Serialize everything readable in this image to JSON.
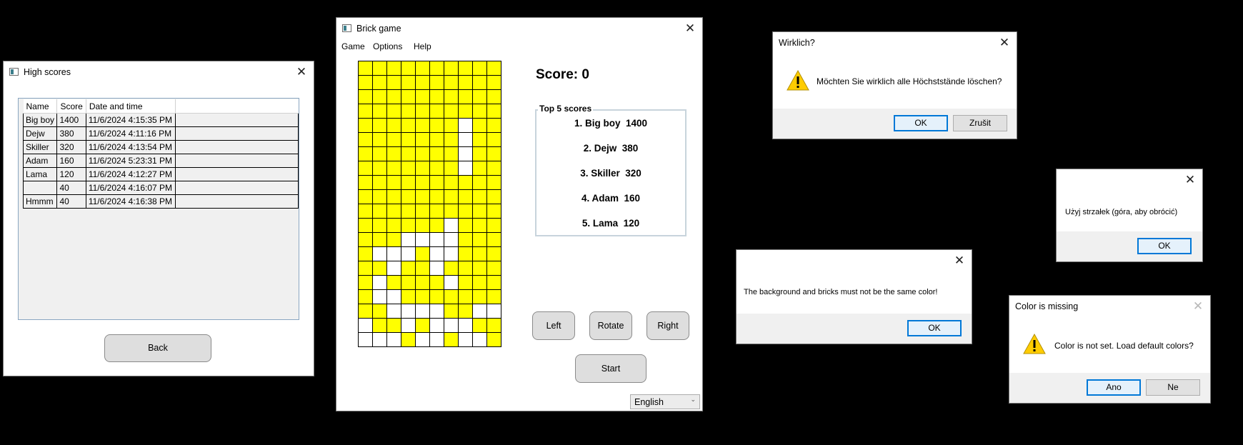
{
  "high_scores_window": {
    "title": "High scores",
    "columns": [
      "Name",
      "Score",
      "Date and time"
    ],
    "rows": [
      {
        "name": "Big boy",
        "score": "1400",
        "date": "11/6/2024 4:15:35 PM"
      },
      {
        "name": "Dejw",
        "score": "380",
        "date": "11/6/2024 4:11:16 PM"
      },
      {
        "name": "Skiller",
        "score": "320",
        "date": "11/6/2024 4:13:54 PM"
      },
      {
        "name": "Adam",
        "score": "160",
        "date": "11/6/2024 5:23:31 PM"
      },
      {
        "name": "Lama",
        "score": "120",
        "date": "11/6/2024 4:12:27 PM"
      },
      {
        "name": "",
        "score": "40",
        "date": "11/6/2024 4:16:07 PM"
      },
      {
        "name": "Hmmm",
        "score": "40",
        "date": "11/6/2024 4:16:38 PM"
      }
    ],
    "back_label": "Back"
  },
  "brick_game_window": {
    "title": "Brick game",
    "menu": [
      "Game",
      "Options",
      "Help"
    ],
    "score_text": "Score: 0",
    "top5_legend": "Top 5 scores",
    "top5": [
      "1. Big boy  1400",
      "2. Dejw  380",
      "3. Skiller  320",
      "4. Adam  160",
      "5. Lama  120"
    ],
    "left_label": "Left",
    "rotate_label": "Rotate",
    "right_label": "Right",
    "start_label": "Start",
    "language": "English",
    "board": [
      "YYYYYYYYYY",
      "YYYYYYYYYY",
      "YYYYYYYYYY",
      "YYYYYYYYYY",
      "YYYYYYYWYY",
      "YYYYYYYWYY",
      "YYYYYYYWYY",
      "YYYYYYYWYY",
      "YYYYYYYYYY",
      "YYYYYYYYYY",
      "YYYYYYYYYY",
      "YYYYYYWYYY",
      "YYYWWWWYYY",
      "YWWWYWWYYY",
      "YYWYYWYYYY",
      "YWYYYYWYYY",
      "YWWYYYYYYY",
      "YYWWWWYYWW",
      "WYYWYWWWYY",
      "WWWYWWYWWY"
    ],
    "colors": {
      "brick": "#ffff00",
      "background": "#ffffff"
    }
  },
  "dialog_wirklich": {
    "title": "Wirklich?",
    "message": "Möchten Sie wirklich alle Höchststände löschen?",
    "ok_label": "OK",
    "cancel_label": "Zrušit"
  },
  "dialog_arrows": {
    "message": "Użyj strzałek (góra, aby obrócić)",
    "ok_label": "OK"
  },
  "dialog_same_color": {
    "message": "The background and bricks must not be the same color!",
    "ok_label": "OK"
  },
  "dialog_color_missing": {
    "title": "Color is missing",
    "message": "Color is not set. Load default colors?",
    "yes_label": "Ano",
    "no_label": "Ne"
  }
}
